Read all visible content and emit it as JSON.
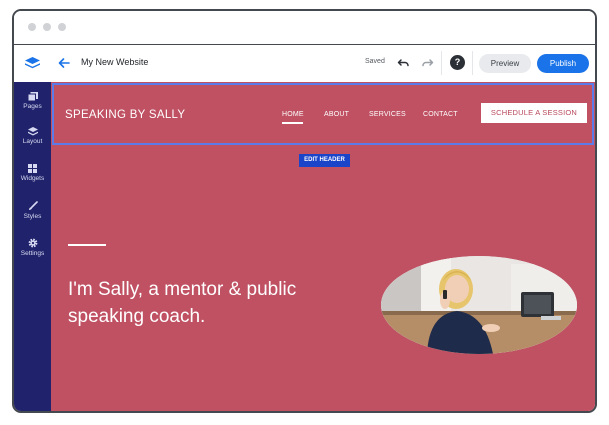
{
  "toolbar": {
    "site_name": "My New Website",
    "saved_label": "Saved",
    "help_label": "?",
    "preview_label": "Preview",
    "publish_label": "Publish"
  },
  "sidebar": {
    "items": [
      {
        "label": "Pages",
        "icon": "pages-icon"
      },
      {
        "label": "Layout",
        "icon": "layout-icon"
      },
      {
        "label": "Widgets",
        "icon": "widgets-icon"
      },
      {
        "label": "Styles",
        "icon": "brush-icon"
      },
      {
        "label": "Settings",
        "icon": "gear-icon"
      }
    ]
  },
  "site": {
    "brand": "SPEAKING BY SALLY",
    "nav": [
      "HOME",
      "ABOUT",
      "SERVICES",
      "CONTACT"
    ],
    "active_nav": "HOME",
    "cta": "SCHEDULE A SESSION",
    "edit_header_label": "EDIT HEADER",
    "hero_title": "I'm Sally, a mentor & public speaking coach."
  },
  "colors": {
    "accent": "#1a73e8",
    "sidebar": "#20236b",
    "canvas": "#bf5163",
    "selection": "#5b7be8",
    "edit_badge": "#1b45c9"
  }
}
